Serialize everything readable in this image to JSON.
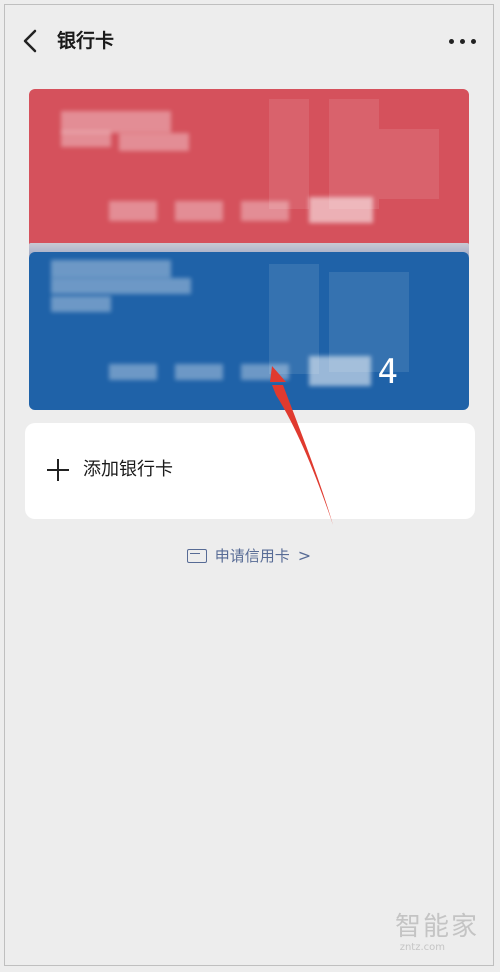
{
  "header": {
    "title": "银行卡",
    "back_icon": "chevron-left-icon",
    "more_icon": "more-horizontal-icon"
  },
  "cards": [
    {
      "color": "#d5515c",
      "type": "red"
    },
    {
      "color": "#1f62a8",
      "type": "blue",
      "last_digit": "4"
    }
  ],
  "add_card": {
    "label": "添加银行卡",
    "icon": "plus-icon"
  },
  "apply_credit": {
    "label": "申请信用卡",
    "icon": "card-icon",
    "chevron": ">"
  },
  "watermark": {
    "text": "智能家",
    "sub": "zntz.com"
  },
  "colors": {
    "background": "#ededed",
    "link": "#576b95",
    "arrow": "#e03a2f"
  }
}
